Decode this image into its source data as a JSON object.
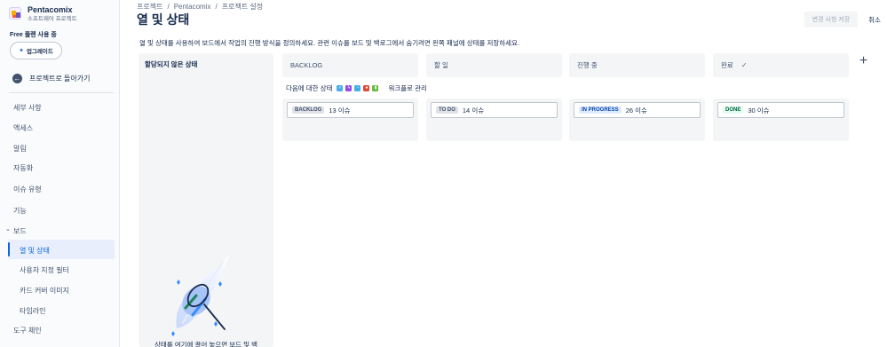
{
  "project": {
    "name": "Pentacomix",
    "type": "소프트웨어 프로젝트"
  },
  "plan": {
    "label": "Free 플랜 사용 중",
    "upgrade_label": "업그레이드"
  },
  "sidebar": {
    "back_label": "프로젝트로 돌아가기",
    "items": [
      {
        "label": "세부 사항"
      },
      {
        "label": "액세스"
      },
      {
        "label": "알림"
      },
      {
        "label": "자동화"
      },
      {
        "label": "이슈 유형"
      },
      {
        "label": "기능"
      },
      {
        "label": "보드"
      },
      {
        "label": "열 및 상태"
      },
      {
        "label": "사용자 지정 필터"
      },
      {
        "label": "카드 커버 이미지"
      },
      {
        "label": "타임라인"
      },
      {
        "label": "도구 체인"
      }
    ]
  },
  "header": {
    "breadcrumbs": [
      "프로젝트",
      "Pentacomix",
      "프로젝트 설정"
    ],
    "separator": "/",
    "title": "열 및 상태",
    "save_label": "변경 사항 저장",
    "cancel_label": "취소",
    "description": "열 및 상태를 사용하여 보드에서 작업의 진행 방식을 정의하세요. 관련 이슈를 보드 및 백로그에서 숨기려면 왼쪽 패널에 상태를 저장하세요."
  },
  "unassigned": {
    "title": "할당되지 않은 상태",
    "empty_text": "상태를 여기에 끌어 놓으면 보드 및 백"
  },
  "status_row": {
    "label": "다음에 대한 상태",
    "workflow_label": "워크플로 관리",
    "issue_type_colors": [
      "#4bade8",
      "#904ee2",
      "#4bade8",
      "#e5493a",
      "#63ba3c"
    ]
  },
  "columns": [
    {
      "header": "BACKLOG",
      "lozenge": "BACKLOG",
      "count": "13 이슈"
    },
    {
      "header": "할 일",
      "lozenge": "TO DO",
      "count": "14 이슈"
    },
    {
      "header": "진행 중",
      "lozenge": "IN PROGRESS",
      "count": "26 이슈"
    },
    {
      "header": "완료",
      "lozenge": "DONE",
      "count": "30 이슈"
    }
  ],
  "colors": {
    "accent": "#0c66e4",
    "column_bg": "#f4f5f7",
    "todo_lozenge": "#deebff",
    "done_lozenge": "#e3fcef"
  }
}
